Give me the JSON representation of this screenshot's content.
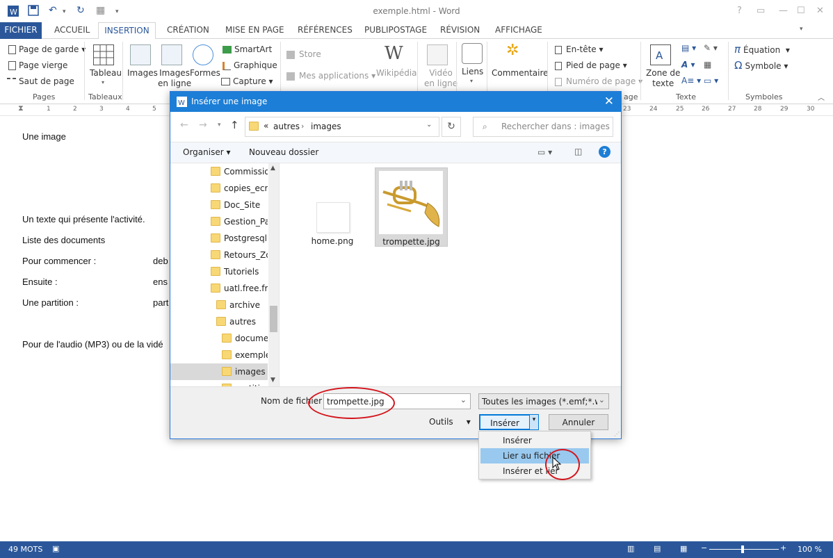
{
  "window": {
    "title": "exemple.html - Word"
  },
  "tabs": [
    "FICHIER",
    "ACCUEIL",
    "INSERTION",
    "CRÉATION",
    "MISE EN PAGE",
    "RÉFÉRENCES",
    "PUBLIPOSTAGE",
    "RÉVISION",
    "AFFICHAGE"
  ],
  "ribbon": {
    "pages": {
      "page_garde": "Page de garde",
      "page_vierge": "Page vierge",
      "saut_page": "Saut de page",
      "group": "Pages"
    },
    "tableaux": {
      "tableau": "Tableau",
      "group": "Tableaux"
    },
    "illustrations": {
      "images": "Images",
      "images_en_ligne": "Images\nen ligne",
      "formes": "Formes",
      "smartart": "SmartArt",
      "graphique": "Graphique",
      "capture": "Capture"
    },
    "apps": {
      "store": "Store",
      "mes_applications": "Mes applications",
      "wikipedia": "Wikipédia"
    },
    "media": {
      "video": "Vidéo\nen ligne"
    },
    "liens": {
      "liens": "Liens"
    },
    "commentaires": {
      "commentaire": "Commentaire"
    },
    "entete": {
      "en_tete": "En-tête",
      "pied_page": "Pied de page",
      "numero_page": "Numéro de page",
      "group_tail": "age"
    },
    "texte": {
      "zone_texte": "Zone de\ntexte",
      "group": "Texte"
    },
    "symboles": {
      "equation": "Équation",
      "symbole": "Symbole",
      "group": "Symboles"
    }
  },
  "ruler": {
    "left": [
      "1",
      "2",
      "3",
      "4",
      "5"
    ],
    "right": [
      "23",
      "24",
      "25",
      "26",
      "27",
      "28",
      "29",
      "30"
    ]
  },
  "document": {
    "line1": "Une image",
    "line2": "Un texte qui présente l'activité.",
    "line3": "Liste des documents",
    "line4_label": "Pour commencer :",
    "line4_val": "deb",
    "line5_label": "Ensuite :",
    "line5_val": "ens",
    "line6_label": "Une partition :",
    "line6_val": "part",
    "line7": "Pour de l'audio (MP3) ou de la vidé"
  },
  "status": {
    "words": "49 MOTS",
    "zoom": "100 %"
  },
  "dialog": {
    "title": "Insérer une image",
    "breadcrumb": [
      "autres",
      "images"
    ],
    "breadcrumb_prefix": "«",
    "search_placeholder": "Rechercher dans : images",
    "organiser": "Organiser",
    "nouveau_dossier": "Nouveau dossier",
    "nav_items": [
      "Commission",
      "copies_ecra",
      "Doc_Site",
      "Gestion_Pag",
      "Postgresql",
      "Retours_Zoo",
      "Tutoriels",
      "uatl.free.fr",
      "archive",
      "autres",
      "documen",
      "exemple_",
      "images",
      "partiti"
    ],
    "files": [
      {
        "name": "home.png"
      },
      {
        "name": "trompette.jpg"
      }
    ],
    "filename_label": "Nom de fichier :",
    "filename_value": "trompette.jpg",
    "filetype": "Toutes les images (*.emf;*.wmf;",
    "outils": "Outils",
    "inserer": "Insérer",
    "annuler": "Annuler",
    "menu": [
      "Insérer",
      "Lier au fichier",
      "Insérer et lier"
    ]
  }
}
